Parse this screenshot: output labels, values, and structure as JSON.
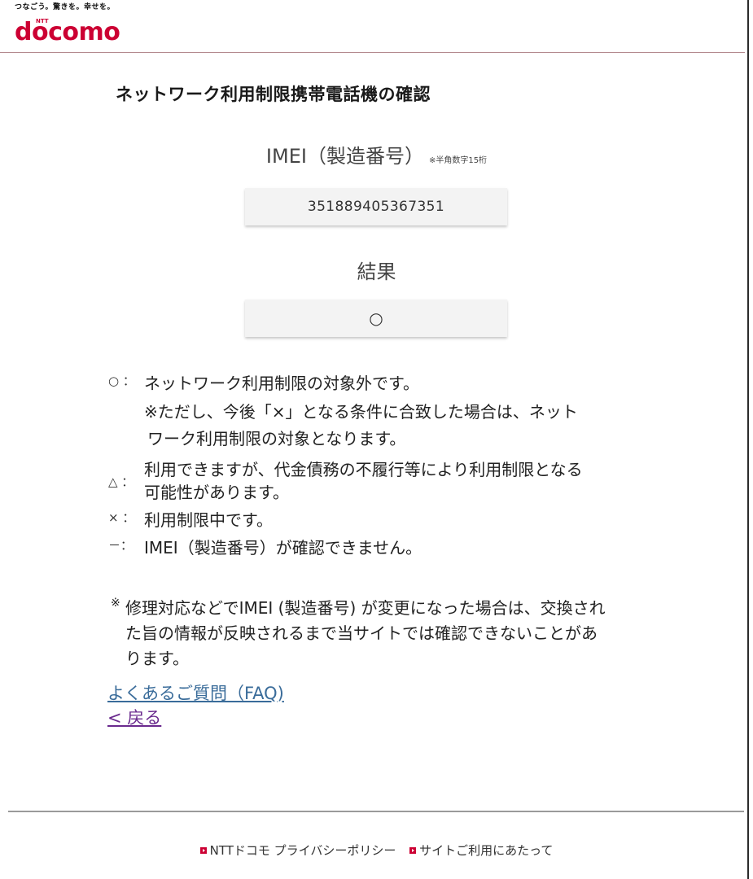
{
  "header": {
    "tagline": "つなごう。驚きを。幸せを。",
    "logo_ntt": "NTT",
    "logo_word": "docomo"
  },
  "page": {
    "title": "ネットワーク利用制限携帯電話機の確認"
  },
  "imei": {
    "label": "IMEI（製造番号）",
    "note": "※半角数字15桁",
    "value": "351889405367351"
  },
  "result": {
    "label": "結果",
    "value": "○"
  },
  "legend": {
    "items": [
      {
        "symbol": "○ ：",
        "text": "ネットワーク利用制限の対象外です。",
        "subtext_line1": "※ただし、今後「×」となる条件に合致した場合は、ネット",
        "subtext_line2": "ワーク利用制限の対象となります。"
      },
      {
        "symbol": "△ ：",
        "text_line1": "利用できますが、代金債務の不履行等により利用制限となる",
        "text_line2": "可能性があります。"
      },
      {
        "symbol": "× ：",
        "text": "利用制限中です。"
      },
      {
        "symbol": "－：",
        "text": "IMEI（製造番号）が確認できません。"
      }
    ]
  },
  "note": {
    "mark": "※",
    "line1": "修理対応などでIMEI (製造番号) が変更になった場合は、交換され",
    "line2": "た旨の情報が反映されるまで当サイトでは確認できないことがあ",
    "line3": "ります。"
  },
  "links": {
    "faq": "よくあるご質問（FAQ)",
    "back": "< 戻る"
  },
  "footer": {
    "privacy": "NTTドコモ プライバシーポリシー",
    "terms": "サイトご利用にあたって"
  }
}
